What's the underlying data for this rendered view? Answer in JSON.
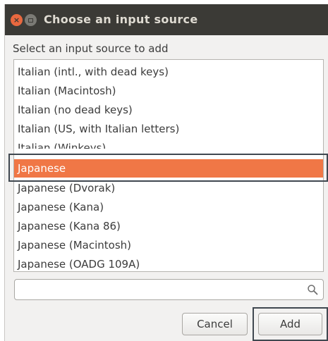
{
  "window": {
    "title": "Choose an input source",
    "close_glyph": "×"
  },
  "prompt": "Select an input source to add",
  "list": {
    "items": [
      {
        "label": "Italian (intl., with dead keys)"
      },
      {
        "label": "Italian (Macintosh)"
      },
      {
        "label": "Italian (no dead keys)"
      },
      {
        "label": "Italian (US, with Italian letters)"
      },
      {
        "label": "Italian (Winkeys)"
      },
      {
        "label": "Japanese"
      },
      {
        "label": "Japanese (Dvorak)"
      },
      {
        "label": "Japanese (Kana)"
      },
      {
        "label": "Japanese (Kana 86)"
      },
      {
        "label": "Japanese (Macintosh)"
      },
      {
        "label": "Japanese (OADG 109A)"
      }
    ],
    "selected": "Japanese",
    "selection_color": "#f07746"
  },
  "search": {
    "value": "",
    "icon": "search-icon"
  },
  "buttons": {
    "cancel": "Cancel",
    "add": "Add"
  }
}
